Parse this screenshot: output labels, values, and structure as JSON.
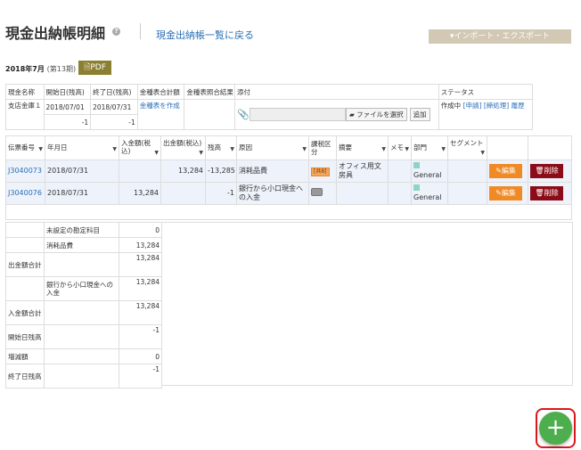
{
  "header": {
    "title": "現金出納帳明細",
    "help_icon": "?",
    "back_link": "現金出納帳一覧に戻る",
    "import_export": "▾インポート・エクスポート"
  },
  "period": {
    "label": "2018年7月",
    "sub": "(第13期)",
    "pdf_button": "PDF"
  },
  "summary_table": {
    "headers": [
      "現金名称",
      "開始日(残高)",
      "終了日(残高)",
      "金種表合計額",
      "金種表照合結果",
      "添付",
      "ステータス"
    ],
    "name": "支店金庫１",
    "start_date": "2018/07/01",
    "end_date": "2018/07/31",
    "start_balance": "-1",
    "end_balance": "-1",
    "denomination_link": "金種表を作成",
    "file_select": "ファイルを選択",
    "add_button": "追加",
    "status_text": "作成中",
    "status_links": [
      "[申請]",
      "[締処理]",
      "履歴"
    ]
  },
  "entries_table": {
    "headers": [
      "伝票番号",
      "年月日",
      "入金額(税込)",
      "出金額(税込)",
      "残高",
      "原因",
      "課税区分",
      "摘要",
      "メモ",
      "部門",
      "セグメント",
      "",
      ""
    ],
    "rows": [
      {
        "voucher": "J3040073",
        "date": "2018/07/31",
        "deposit": "",
        "withdrawal": "13,284",
        "balance": "-13,285",
        "cause": "消耗品費",
        "tax_tag": "[共8]",
        "summary": "オフィス用文房具",
        "memo": "",
        "department": "General",
        "segment": "",
        "edit": "編集",
        "delete": "削除"
      },
      {
        "voucher": "J3040076",
        "date": "2018/07/31",
        "deposit": "13,284",
        "withdrawal": "",
        "balance": "-1",
        "cause": "銀行から小口現金への入金",
        "tax_tag": "",
        "summary": "",
        "memo": "",
        "department": "General",
        "segment": "",
        "edit": "編集",
        "delete": "削除"
      }
    ]
  },
  "totals_table": {
    "rows": [
      {
        "label": "",
        "sub": "未設定の勘定科目",
        "value": "0"
      },
      {
        "label": "",
        "sub": "消耗品費",
        "value": "13,284"
      },
      {
        "label": "出金額合計",
        "sub": "",
        "value": "13,284"
      },
      {
        "label": "",
        "sub": "銀行から小口現金への入金",
        "value": "13,284"
      },
      {
        "label": "入金額合計",
        "sub": "",
        "value": "13,284"
      },
      {
        "label": "開始日残高",
        "sub": "",
        "value": "-1"
      },
      {
        "label": "増減額",
        "sub": "",
        "value": "0"
      },
      {
        "label": "終了日残高",
        "sub": "",
        "value": "-1"
      }
    ]
  },
  "fab": {
    "label": "+"
  },
  "colors": {
    "link": "#2a6fb5",
    "pdf": "#8b8032",
    "edit": "#f08a24",
    "delete": "#8b0c18",
    "fab": "#4cae4c",
    "highlight": "#d9181b"
  }
}
